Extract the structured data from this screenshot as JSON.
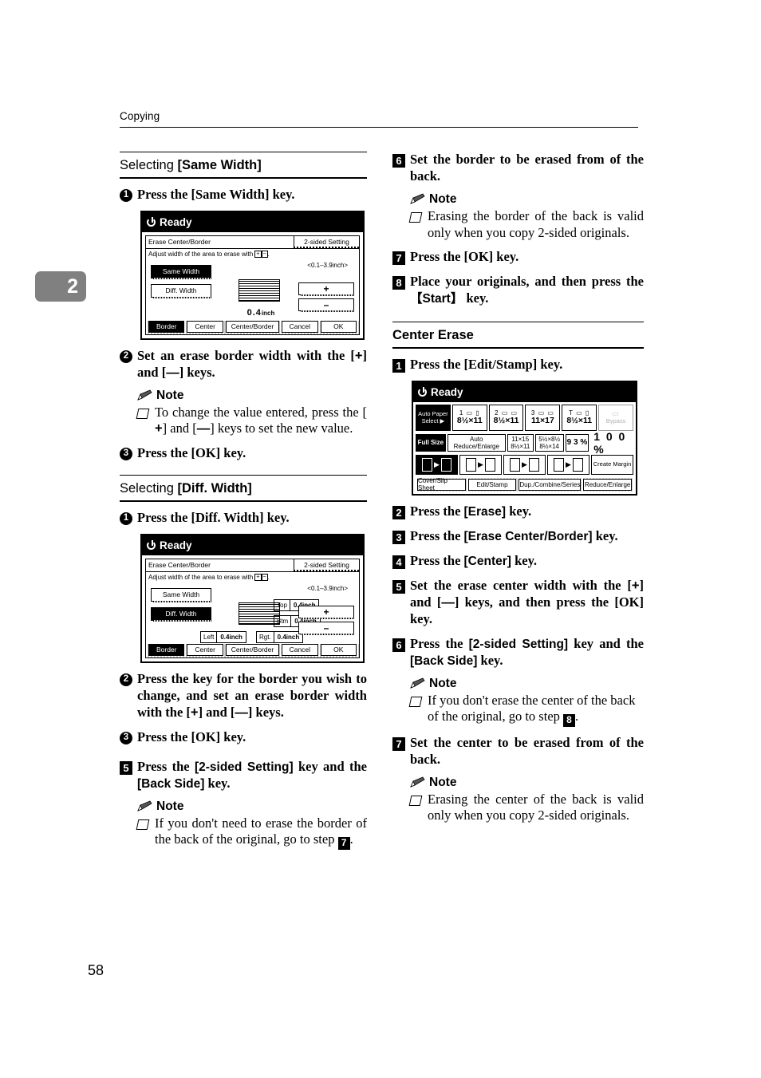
{
  "header": {
    "running_head": "Copying",
    "chapter_tab": "2",
    "page_number": "58"
  },
  "left_column": {
    "section1": {
      "title_prefix": "Selecting ",
      "title_key": "[Same Width]",
      "steps": [
        {
          "num": "1",
          "text": "Press the [Same Width] key."
        }
      ],
      "step2": {
        "num": "2",
        "text_a": "Set an erase border width with the [",
        "plus": "+",
        "text_b": "] and [",
        "minus": "—",
        "text_c": "] keys."
      },
      "note_label": "Note",
      "note_item": {
        "text_a": "To change the value entered, press the [",
        "plus": "+",
        "text_b": "] and [",
        "minus": "—",
        "text_c": "] keys to set the new value."
      },
      "step3": {
        "num": "3",
        "text": "Press the [OK] key."
      }
    },
    "section2": {
      "title_prefix": "Selecting ",
      "title_key": "[Diff. Width]",
      "step1": {
        "num": "1",
        "text": "Press the [Diff. Width] key."
      },
      "step2": {
        "num": "2",
        "text_a": "Press the key for the border you wish to change, and set an erase border width with the [",
        "plus": "+",
        "text_b": "] and [",
        "minus": "—",
        "text_c": "] keys."
      },
      "step3": {
        "num": "3",
        "text": "Press the [OK] key."
      }
    },
    "step5": {
      "num": "5",
      "text_a": "Press the ",
      "key1": "[2-sided Setting]",
      "text_b": " key and the ",
      "key2": "[Back Side]",
      "text_c": " key."
    },
    "note_label": "Note",
    "note5": {
      "text_a": "If you don't need to erase the border of the back of the original, go to step ",
      "stepref": "7",
      "text_b": "."
    }
  },
  "right_column": {
    "step6": {
      "num": "6",
      "text": "Set the border to be erased from of the back."
    },
    "note6_label": "Note",
    "note6": "Erasing the border of the back is valid only when you copy 2-sided originals.",
    "step7": {
      "num": "7",
      "text": "Press the [OK] key."
    },
    "step8": {
      "num": "8",
      "text_a": "Place your originals, and then press the ",
      "key": "【Start】",
      "text_b": " key."
    },
    "section": {
      "title": "Center Erase",
      "step1": {
        "num": "1",
        "text": "Press the [Edit/Stamp] key."
      },
      "step2": {
        "num": "2",
        "text_a": "Press the ",
        "key": "[Erase]",
        "text_b": " key."
      },
      "step3": {
        "num": "3",
        "text_a": "Press the ",
        "key": "[Erase Center/Border]",
        "text_b": " key."
      },
      "step4": {
        "num": "4",
        "text_a": "Press the ",
        "key": "[Center]",
        "text_b": " key."
      },
      "step5": {
        "num": "5",
        "text_a": "Set the erase center width with the [",
        "plus": "+",
        "text_b": "] and [",
        "minus": "—",
        "text_c": "] keys, and then press the [OK] key."
      },
      "step6": {
        "num": "6",
        "text_a": "Press the ",
        "key1": "[2-sided Setting]",
        "text_b": " key and the ",
        "key2": "[Back Side]",
        "text_c": " key."
      },
      "note6_label": "Note",
      "note6": {
        "text_a": "If you don't erase the center of the back of the original, go to step ",
        "stepref": "8",
        "text_b": "."
      },
      "step7": {
        "num": "7",
        "text": "Set the center to be erased from of the back."
      },
      "note7_label": "Note",
      "note7": "Erasing the center of the back is valid only when you copy 2-sided originals."
    }
  },
  "lcd_same_width": {
    "status": "Ready",
    "dialog_title": "Erase Center/Border",
    "two_sided_tab": "2-sided Setting",
    "instruction_a": "Adjust width of the area to erase with ",
    "instruction_plus": "+",
    "instruction_minus": "−",
    "instruction_b": ".",
    "range": "<0.1–3.9inch>",
    "btn_same_width": "Same Width",
    "btn_diff_width": "Diff. Width",
    "value": "0.4",
    "value_unit": "inch",
    "btn_plus": "+",
    "btn_minus": "–",
    "bottom": {
      "border": "Border",
      "center": "Center",
      "center_border": "Center/Border",
      "cancel": "Cancel",
      "ok": "OK"
    }
  },
  "lcd_diff_width": {
    "status": "Ready",
    "dialog_title": "Erase Center/Border",
    "two_sided_tab": "2-sided Setting",
    "instruction_a": "Adjust width of the area to erase with ",
    "instruction_plus": "+",
    "instruction_minus": "−",
    "instruction_b": ".",
    "range": "<0.1–3.9inch>",
    "btn_same_width": "Same Width",
    "btn_diff_width": "Diff. Width",
    "fields": [
      {
        "label": "Top",
        "value": "0.4inch"
      },
      {
        "label": "Btm",
        "value": "0.4inch"
      },
      {
        "label": "Left",
        "value": "0.4inch"
      },
      {
        "label": "Rgt.",
        "value": "0.4inch"
      }
    ],
    "btn_plus": "+",
    "btn_minus": "–",
    "bottom": {
      "border": "Border",
      "center": "Center",
      "center_border": "Center/Border",
      "cancel": "Cancel",
      "ok": "OK"
    }
  },
  "lcd_copier": {
    "status": "Ready",
    "trays": [
      {
        "label": "Auto Paper Select ▶",
        "icons": "",
        "size": "",
        "selected": true,
        "disabled": false
      },
      {
        "label": "",
        "icons": "1 ▭ ▯",
        "size": "8½×11",
        "selected": false,
        "disabled": false
      },
      {
        "label": "",
        "icons": "2 ▭ ▭",
        "size": "8½×11",
        "selected": false,
        "disabled": false
      },
      {
        "label": "",
        "icons": "3 ▭ ▭",
        "size": "11×17",
        "selected": false,
        "disabled": false
      },
      {
        "label": "",
        "icons": "T ▭ ▯",
        "size": "8½×11",
        "selected": false,
        "disabled": false
      },
      {
        "label": "Bypass",
        "icons": "▭",
        "size": "",
        "selected": false,
        "disabled": true
      }
    ],
    "zoom_row": {
      "full_size": "Full Size",
      "auto_reduce": "Auto Reduce/Enlarge",
      "preset1_top": "11×15",
      "preset1_bot": "8½×11",
      "preset2_top": "5½×8½",
      "preset2_bot": "8½×14",
      "preset3": "9 3 %",
      "current": "1 0 0 %"
    },
    "dup_row": {
      "b1": "1→2 sided",
      "b2": "2→2 sided",
      "b3": "1→1 combine",
      "b4": "1→4 combine",
      "b5": "Create Margin"
    },
    "tabs": [
      "Cover/Slip Sheet",
      "Edit/Stamp",
      "Dup./Combine/Series",
      "Reduce/Enlarge"
    ]
  }
}
